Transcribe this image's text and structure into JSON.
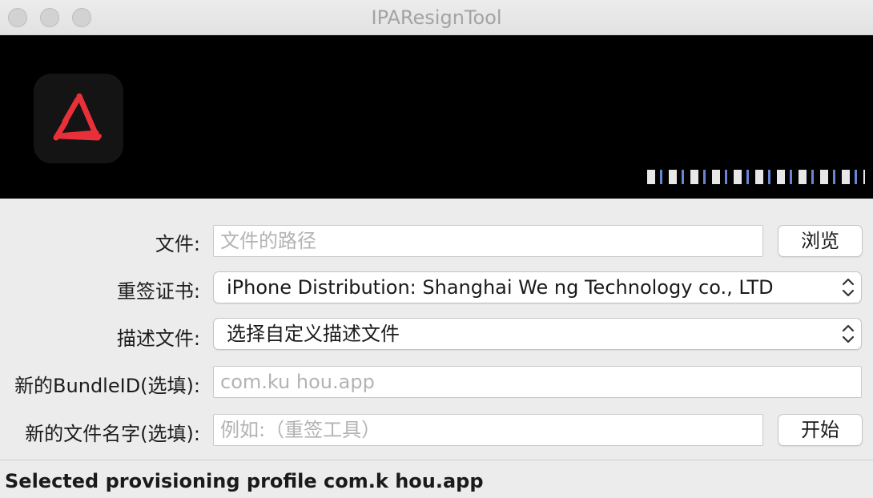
{
  "window": {
    "title": "IPAResignTool"
  },
  "form": {
    "file": {
      "label": "文件:",
      "placeholder": "文件的路径",
      "value": ""
    },
    "browse_button": "浏览",
    "certificate": {
      "label": "重签证书:",
      "selected": "iPhone Distribution: Shanghai We    ng Technology co., LTD"
    },
    "profile": {
      "label": "描述文件:",
      "selected": "选择自定义描述文件"
    },
    "bundle_id": {
      "label": "新的BundleID(选填):",
      "placeholder": "com.ku       hou.app",
      "value": ""
    },
    "new_name": {
      "label": "新的文件名字(选填):",
      "placeholder": "例如:（重签工具）",
      "value": ""
    },
    "start_button": "开始"
  },
  "status": {
    "text": "Selected provisioning profile com.k       hou.app"
  },
  "icons": [
    "window-close-icon",
    "window-minimize-icon",
    "window-zoom-icon",
    "app-logo-icon",
    "popup-chevrons-icon"
  ],
  "colors": {
    "banner": "#000000",
    "logo_accent": "#e8303a"
  }
}
